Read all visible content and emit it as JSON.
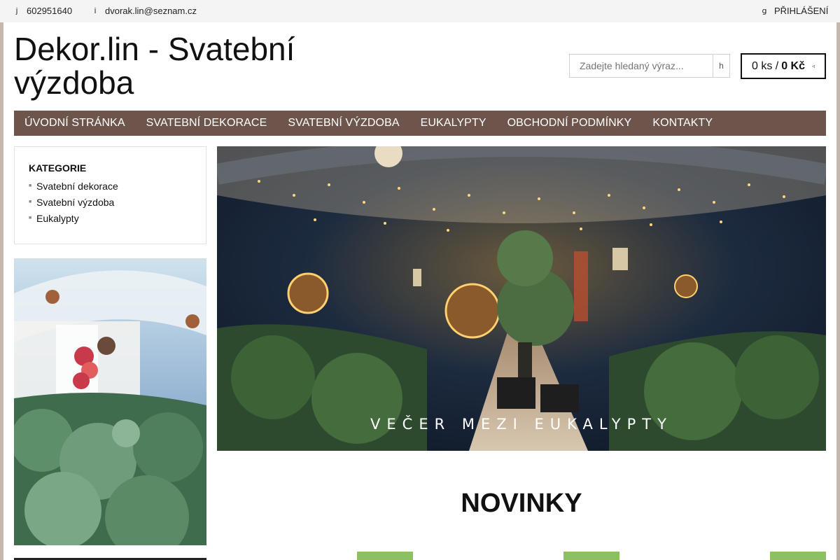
{
  "topbar": {
    "phone": "602951640",
    "phone_icon": "j",
    "email": "dvorak.lin@seznam.cz",
    "email_icon": "i",
    "login_icon": "g",
    "login_label": "PŘIHLÁŠENÍ"
  },
  "header": {
    "title": "Dekor.lin - Svatební výzdoba"
  },
  "search": {
    "placeholder": "Zadejte hledaný výraz...",
    "button_icon": "h"
  },
  "cart": {
    "count": "0 ks /",
    "total": "0 Kč",
    "caret": "◃"
  },
  "nav": {
    "items": [
      {
        "label": "ÚVODNÍ STRÁNKA"
      },
      {
        "label": "SVATEBNÍ DEKORACE"
      },
      {
        "label": "SVATEBNÍ VÝZDOBA"
      },
      {
        "label": "EUKALYPTY"
      },
      {
        "label": "OBCHODNÍ PODMÍNKY"
      },
      {
        "label": "KONTAKTY"
      }
    ]
  },
  "categories": {
    "heading": "KATEGORIE",
    "items": [
      {
        "label": "Svatební dekorace"
      },
      {
        "label": "Svatební výzdoba"
      },
      {
        "label": "Eukalypty"
      }
    ]
  },
  "hero": {
    "caption": "VEČER MEZI EUKALYPTY"
  },
  "main": {
    "section_title": "NOVINKY"
  },
  "colors": {
    "nav_bg": "#6e554c",
    "rail": "#c6b7ac",
    "badge": "#8cc063"
  }
}
